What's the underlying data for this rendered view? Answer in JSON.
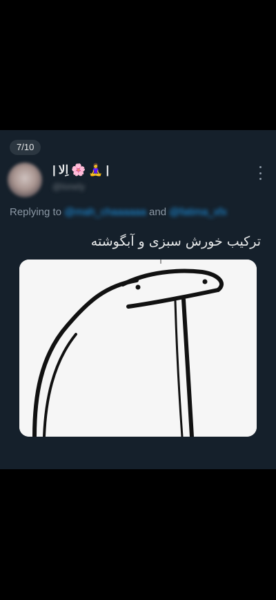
{
  "thread": {
    "counter": "7/10"
  },
  "tweet": {
    "display_name_prefix": "|",
    "display_name_text": "اِلا",
    "display_name_emoji_flower": "🌸",
    "display_name_emoji_person": "🧘‍♀️",
    "display_name_suffix": "|",
    "handle": "@lonely",
    "reply": {
      "prefix": "Replying to",
      "mention_1": "@mah_chaaaaaa",
      "joiner": "and",
      "mention_2": "@fatima_xfx"
    },
    "text": "ترکیب خورش سبزی و آبگوشته"
  },
  "colors": {
    "background": "#000000",
    "card": "#15202b",
    "text_primary": "#e7e9ea",
    "text_secondary": "#8b98a5",
    "link": "#1d9bf0"
  },
  "icons": {
    "more": "more-vertical-icon"
  }
}
